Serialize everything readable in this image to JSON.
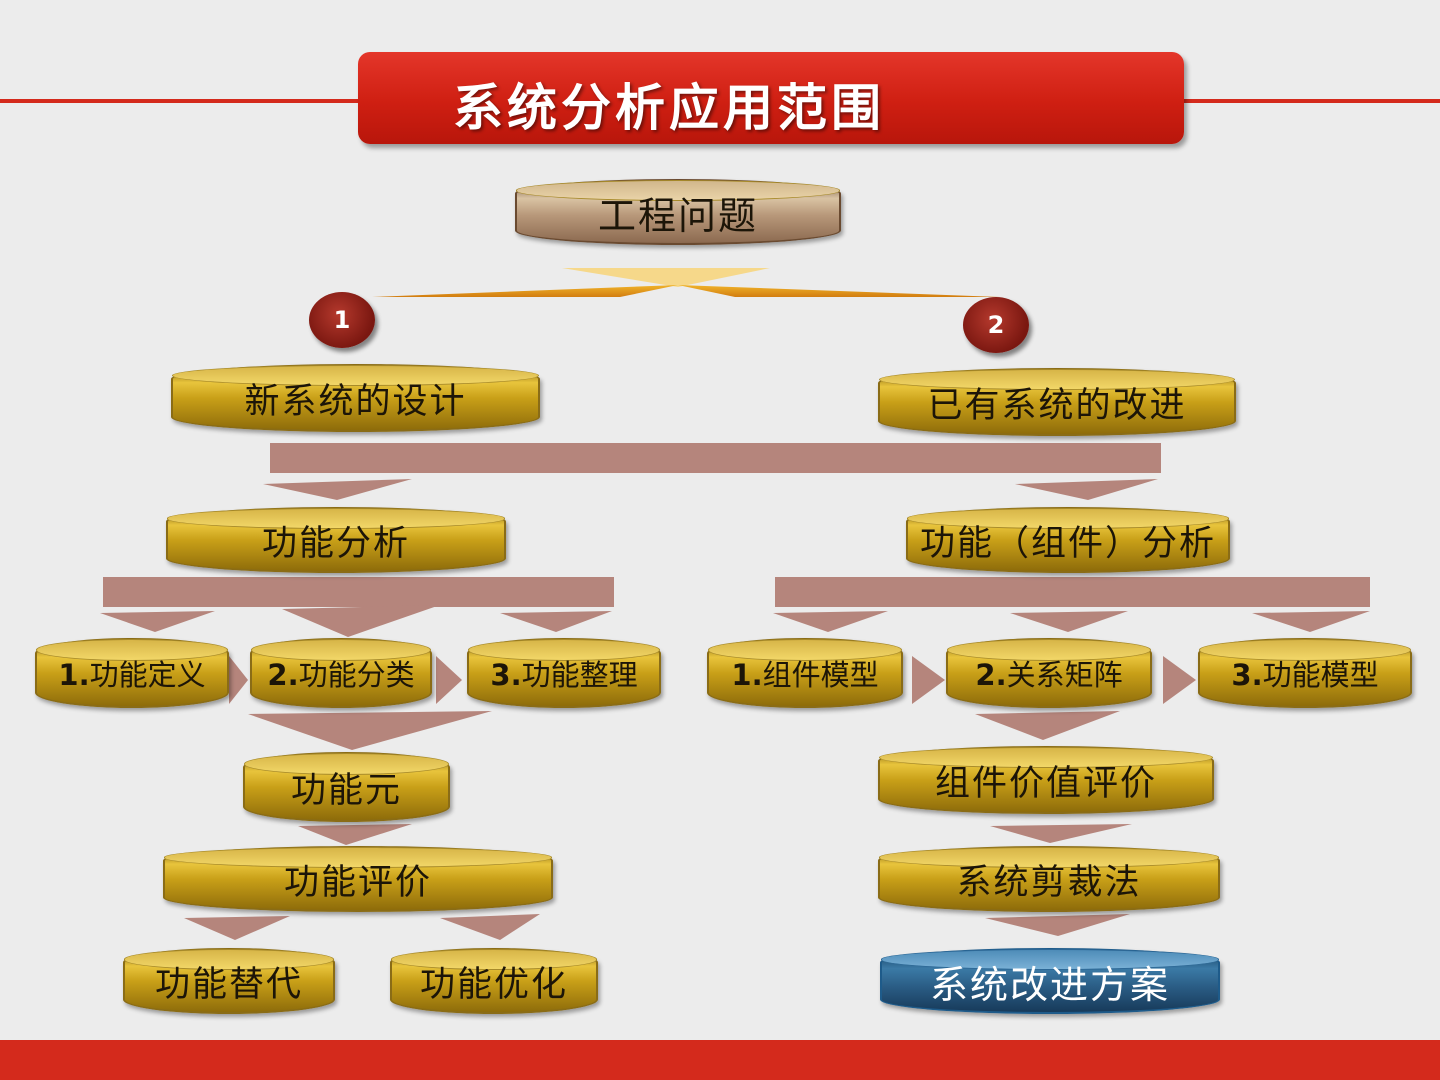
{
  "title": "系统分析应用范围",
  "root": "工程问题",
  "branch1": {
    "number": "1",
    "label": "新系统的设计",
    "analysis": "功能分析",
    "steps": [
      {
        "num": "1.",
        "label": "功能定义"
      },
      {
        "num": "2.",
        "label": "功能分类"
      },
      {
        "num": "3.",
        "label": "功能整理"
      }
    ],
    "element": "功能元",
    "evaluation": "功能评价",
    "outcomes": [
      "功能替代",
      "功能优化"
    ]
  },
  "branch2": {
    "number": "2",
    "label": "已有系统的改进",
    "analysis": "功能（组件）分析",
    "steps": [
      {
        "num": "1.",
        "label": "组件模型"
      },
      {
        "num": "2.",
        "label": "关系矩阵"
      },
      {
        "num": "3.",
        "label": "功能模型"
      }
    ],
    "evaluation": "组件价值评价",
    "method": "系统剪裁法",
    "result": "系统改进方案"
  },
  "colors": {
    "accent_red": "#d42a1c",
    "node_gold": "#c9a018",
    "connector_rose": "#b5857c",
    "result_blue": "#2a5c84"
  }
}
